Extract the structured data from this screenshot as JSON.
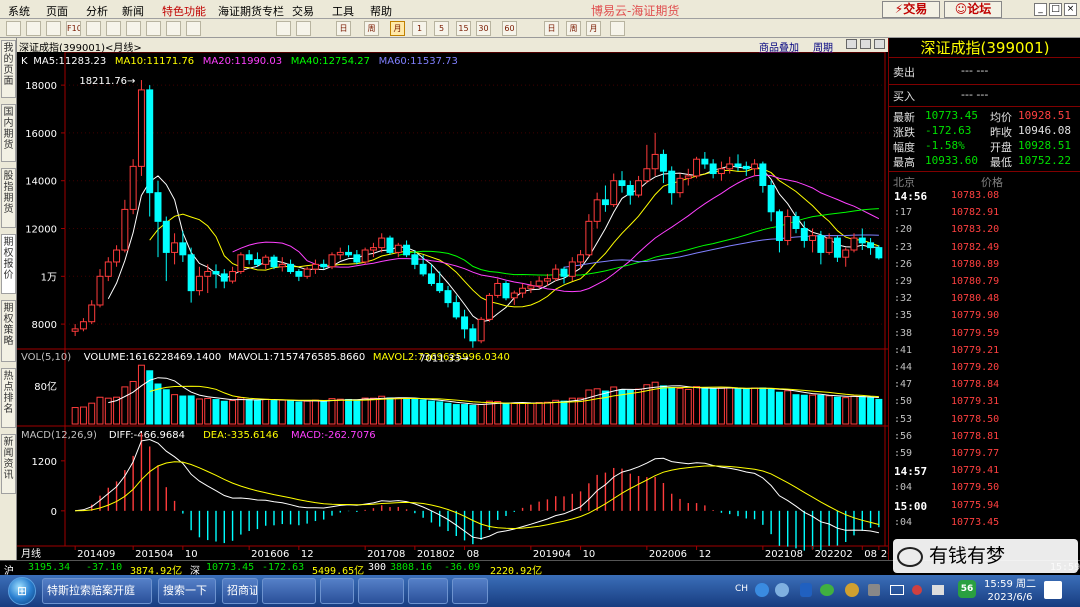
{
  "menu": {
    "items": [
      "系统",
      "页面",
      "分析",
      "新闻",
      "特色功能",
      "海证期货专栏",
      "交易",
      "工具",
      "帮助"
    ],
    "app_title": "博易云-海证期货",
    "trade_btn": "交易",
    "forum_btn": "论坛"
  },
  "toolbar": {
    "buttons": [
      "home",
      "back",
      "fwd",
      "f10",
      "search",
      "zoom",
      "info",
      "alert",
      "tools",
      "grid",
      "list",
      "calc",
      "day",
      "week",
      "month",
      "m1",
      "m5",
      "m15",
      "m30",
      "m60",
      "d",
      "w",
      "m",
      "note"
    ],
    "labels": [
      "",
      "",
      "",
      "F10",
      "",
      "",
      "",
      "",
      "",
      "",
      "",
      "",
      "日",
      "周",
      "月",
      "1",
      "5",
      "15",
      "30",
      "60",
      "日",
      "周",
      "月",
      ""
    ]
  },
  "sidetabs": [
    "我的页面",
    "国内期货",
    "股指期货",
    "期权报价",
    "期权策略",
    "热点排名",
    "新闻资讯"
  ],
  "chart": {
    "name": "深证成指(399001)",
    "period": "月线",
    "overlay_link": "商品叠加",
    "period_btn": "周期",
    "ma_legend": [
      {
        "text": "K",
        "color": "#ffffff"
      },
      {
        "text": "MA5:11283.23",
        "color": "#ffffff"
      },
      {
        "text": "MA10:11171.76",
        "color": "#ffff00"
      },
      {
        "text": "MA20:11990.03",
        "color": "#ff40ff"
      },
      {
        "text": "MA40:12754.27",
        "color": "#00ff00"
      },
      {
        "text": "MA60:11537.73",
        "color": "#8080ff"
      }
    ],
    "vol_legend": [
      {
        "text": "VOL(5,10)",
        "color": "#c0c0c0"
      },
      {
        "text": "VOLUME:1616228469.1400",
        "color": "#ffffff"
      },
      {
        "text": "MAVOL1:7157476585.8660",
        "color": "#ffffff"
      },
      {
        "text": "MAVOL2:7369625996.0340",
        "color": "#ffff00"
      }
    ],
    "macd_legend": [
      {
        "text": "MACD(12,26,9)",
        "color": "#c0c0c0"
      },
      {
        "text": "DIFF:-466.9684",
        "color": "#ffffff"
      },
      {
        "text": "DEA:-335.6146",
        "color": "#ffff00"
      },
      {
        "text": "MACD:-262.7076",
        "color": "#ff40ff"
      }
    ],
    "price_ticks": [
      "18000",
      "16000",
      "14000",
      "12000",
      "1万",
      "8000"
    ],
    "vol_ticks": [
      "80亿"
    ],
    "macd_ticks": [
      "1200",
      "0"
    ],
    "x_label": "月线",
    "x_ticks": [
      "201409",
      "201504",
      "10",
      "201606",
      "12",
      "201708",
      "201802",
      "08",
      "201904",
      "10",
      "202006",
      "12",
      "202108",
      "202202",
      "08",
      "202304"
    ],
    "high_label": "18211.76",
    "low_label": "7011.33"
  },
  "chart_data": {
    "type": "candlestick",
    "title": "深证成指(399001) 月线",
    "price_range": [
      7000,
      18800
    ],
    "start_month": "2014-09",
    "ohlc": [
      [
        7700,
        8000,
        7500,
        7800
      ],
      [
        7800,
        8250,
        7700,
        8100
      ],
      [
        8100,
        9000,
        8000,
        8800
      ],
      [
        8800,
        10300,
        8700,
        10000
      ],
      [
        10000,
        10800,
        9800,
        10600
      ],
      [
        10600,
        11300,
        10400,
        11100
      ],
      [
        11100,
        13200,
        11000,
        12800
      ],
      [
        12800,
        14900,
        12600,
        14600
      ],
      [
        14600,
        18211.76,
        14200,
        17800
      ],
      [
        17800,
        18000,
        12500,
        13500
      ],
      [
        13500,
        14000,
        10800,
        12300
      ],
      [
        12300,
        12500,
        9800,
        11000
      ],
      [
        11000,
        11800,
        10500,
        11400
      ],
      [
        11400,
        11900,
        10600,
        10900
      ],
      [
        10900,
        11200,
        8900,
        9400
      ],
      [
        9400,
        10400,
        9200,
        10000
      ],
      [
        10000,
        10500,
        9300,
        10200
      ],
      [
        10200,
        10500,
        9500,
        10100
      ],
      [
        10100,
        10300,
        9500,
        9800
      ],
      [
        9800,
        10400,
        9700,
        10200
      ],
      [
        10200,
        11000,
        10100,
        10900
      ],
      [
        10900,
        11100,
        10500,
        10700
      ],
      [
        10700,
        11000,
        10400,
        10500
      ],
      [
        10500,
        10900,
        10300,
        10800
      ],
      [
        10800,
        10900,
        10300,
        10400
      ],
      [
        10400,
        10800,
        10200,
        10500
      ],
      [
        10500,
        10700,
        10100,
        10200
      ],
      [
        10200,
        10300,
        9800,
        10000
      ],
      [
        10000,
        10400,
        9900,
        10300
      ],
      [
        10300,
        10700,
        10100,
        10500
      ],
      [
        10500,
        10700,
        10300,
        10400
      ],
      [
        10400,
        11000,
        10300,
        10900
      ],
      [
        10900,
        11200,
        10700,
        11000
      ],
      [
        11000,
        11300,
        10800,
        10900
      ],
      [
        10900,
        11100,
        10500,
        10600
      ],
      [
        10600,
        11200,
        10500,
        11100
      ],
      [
        11100,
        11400,
        10800,
        11200
      ],
      [
        11200,
        11800,
        11000,
        11600
      ],
      [
        11600,
        11700,
        10900,
        11000
      ],
      [
        11000,
        11400,
        10800,
        11300
      ],
      [
        11300,
        11500,
        10800,
        10900
      ],
      [
        10900,
        11100,
        10300,
        10500
      ],
      [
        10500,
        10900,
        10000,
        10100
      ],
      [
        10100,
        10500,
        9600,
        9700
      ],
      [
        9700,
        10200,
        9300,
        9400
      ],
      [
        9400,
        9600,
        8700,
        8900
      ],
      [
        8900,
        9200,
        8200,
        8300
      ],
      [
        8300,
        8600,
        7400,
        7800
      ],
      [
        7800,
        8000,
        7011.33,
        7300
      ],
      [
        7300,
        8300,
        7200,
        8200
      ],
      [
        8200,
        9300,
        8100,
        9200
      ],
      [
        9200,
        9900,
        9100,
        9700
      ],
      [
        9700,
        9800,
        9000,
        9100
      ],
      [
        9100,
        9400,
        8800,
        9300
      ],
      [
        9300,
        9700,
        9100,
        9500
      ],
      [
        9500,
        9800,
        9300,
        9600
      ],
      [
        9600,
        10000,
        9500,
        9800
      ],
      [
        9800,
        10100,
        9600,
        9900
      ],
      [
        9900,
        10500,
        9800,
        10300
      ],
      [
        10300,
        10400,
        9700,
        10000
      ],
      [
        10000,
        10800,
        9800,
        10600
      ],
      [
        10600,
        11100,
        10300,
        10900
      ],
      [
        10900,
        12600,
        10800,
        12300
      ],
      [
        12300,
        13500,
        12000,
        13200
      ],
      [
        13200,
        13800,
        12700,
        13000
      ],
      [
        13000,
        14300,
        12900,
        14000
      ],
      [
        14000,
        14400,
        13500,
        13800
      ],
      [
        13800,
        14000,
        13000,
        13400
      ],
      [
        13400,
        14200,
        13300,
        14000
      ],
      [
        14000,
        15500,
        13900,
        14500
      ],
      [
        14500,
        16000,
        14200,
        15100
      ],
      [
        15100,
        15300,
        13900,
        14400
      ],
      [
        14400,
        14600,
        13000,
        13500
      ],
      [
        13500,
        14300,
        13300,
        14100
      ],
      [
        14100,
        14500,
        13800,
        14200
      ],
      [
        14200,
        15000,
        14100,
        14900
      ],
      [
        14900,
        15200,
        14500,
        14700
      ],
      [
        14700,
        14900,
        14100,
        14300
      ],
      [
        14300,
        14800,
        14000,
        14500
      ],
      [
        14500,
        15000,
        14300,
        14700
      ],
      [
        14700,
        15100,
        14400,
        14600
      ],
      [
        14600,
        14800,
        14200,
        14500
      ],
      [
        14500,
        14900,
        14200,
        14700
      ],
      [
        14700,
        14800,
        13500,
        13800
      ],
      [
        13800,
        14000,
        12300,
        12700
      ],
      [
        12700,
        12800,
        11000,
        11500
      ],
      [
        11500,
        12800,
        11300,
        12500
      ],
      [
        12500,
        12700,
        11800,
        12000
      ],
      [
        12000,
        12300,
        11200,
        11500
      ],
      [
        11500,
        12000,
        11000,
        11700
      ],
      [
        11700,
        11900,
        10500,
        11000
      ],
      [
        11000,
        11800,
        10900,
        11600
      ],
      [
        11600,
        11700,
        10600,
        10800
      ],
      [
        10800,
        11200,
        10400,
        11100
      ],
      [
        11100,
        11800,
        11000,
        11600
      ],
      [
        11600,
        12000,
        11100,
        11400
      ],
      [
        11400,
        11600,
        10900,
        11200
      ],
      [
        11200,
        11300,
        10700,
        10773
      ]
    ],
    "volume_range": [
      0,
      13000000000
    ],
    "macd_range": [
      -700,
      1700
    ]
  },
  "quote": {
    "title": "深证成指(399001)",
    "sell_label": "卖出",
    "buy_label": "买入",
    "sell_val": "---   ---",
    "buy_val": "---   ---",
    "rows": [
      {
        "l1": "最新",
        "v1": "10773.45",
        "c1": "grn",
        "l2": "均价",
        "v2": "10928.51",
        "c2": "red"
      },
      {
        "l1": "涨跌",
        "v1": "-172.63",
        "c1": "grn",
        "l2": "昨收",
        "v2": "10946.08",
        "c2": "ql"
      },
      {
        "l1": "幅度",
        "v1": "-1.58%",
        "c1": "grn",
        "l2": "开盘",
        "v2": "10928.51",
        "c2": "grn"
      },
      {
        "l1": "最高",
        "v1": "10933.60",
        "c1": "grn",
        "l2": "最低",
        "v2": "10752.22",
        "c2": "grn"
      }
    ],
    "tick_header_l": "北京",
    "tick_header_r": "价格",
    "ticks": [
      {
        "t": "14:56",
        "p": "10783.08",
        "b": true
      },
      {
        "t": ":17",
        "p": "10782.91"
      },
      {
        "t": ":20",
        "p": "10783.20"
      },
      {
        "t": ":23",
        "p": "10782.49"
      },
      {
        "t": ":26",
        "p": "10780.89"
      },
      {
        "t": ":29",
        "p": "10780.79"
      },
      {
        "t": ":32",
        "p": "10780.48"
      },
      {
        "t": ":35",
        "p": "10779.90"
      },
      {
        "t": ":38",
        "p": "10779.59"
      },
      {
        "t": ":41",
        "p": "10779.21"
      },
      {
        "t": ":44",
        "p": "10779.20"
      },
      {
        "t": ":47",
        "p": "10778.84"
      },
      {
        "t": ":50",
        "p": "10779.31"
      },
      {
        "t": ":53",
        "p": "10778.50"
      },
      {
        "t": ":56",
        "p": "10778.81"
      },
      {
        "t": ":59",
        "p": "10779.77"
      },
      {
        "t": "14:57",
        "p": "10779.41",
        "b": true
      },
      {
        "t": ":04",
        "p": "10779.50"
      },
      {
        "t": "15:00",
        "p": "10775.94",
        "b": true
      },
      {
        "t": ":04",
        "p": "10773.45"
      }
    ]
  },
  "status": [
    {
      "text": "沪",
      "color": "#ffffff"
    },
    {
      "text": "3195.34",
      "color": "#00e000"
    },
    {
      "text": "-37.10",
      "color": "#00e000"
    },
    {
      "text": "3874.92亿",
      "color": "#ffff00"
    },
    {
      "text": "深",
      "color": "#ffffff"
    },
    {
      "text": "10773.45",
      "color": "#00e000"
    },
    {
      "text": "-172.63",
      "color": "#00e000"
    },
    {
      "text": "5499.65亿",
      "color": "#ffff00"
    },
    {
      "text": "300",
      "color": "#ffffff"
    },
    {
      "text": "3808.16",
      "color": "#00e000"
    },
    {
      "text": "-36.09",
      "color": "#00e000"
    },
    {
      "text": "2220.92亿",
      "color": "#ffff00"
    }
  ],
  "status_time": "15:59",
  "taskbar": {
    "start": "⊞",
    "tasks": [
      "特斯拉索赔案开庭",
      "搜索一下",
      "招商证券",
      "",
      "",
      "",
      "",
      ""
    ],
    "tray_lang": "CH",
    "tray_badge": "56",
    "time": "15:59 周二",
    "date": "2023/6/6"
  },
  "watermark": "有钱有梦"
}
